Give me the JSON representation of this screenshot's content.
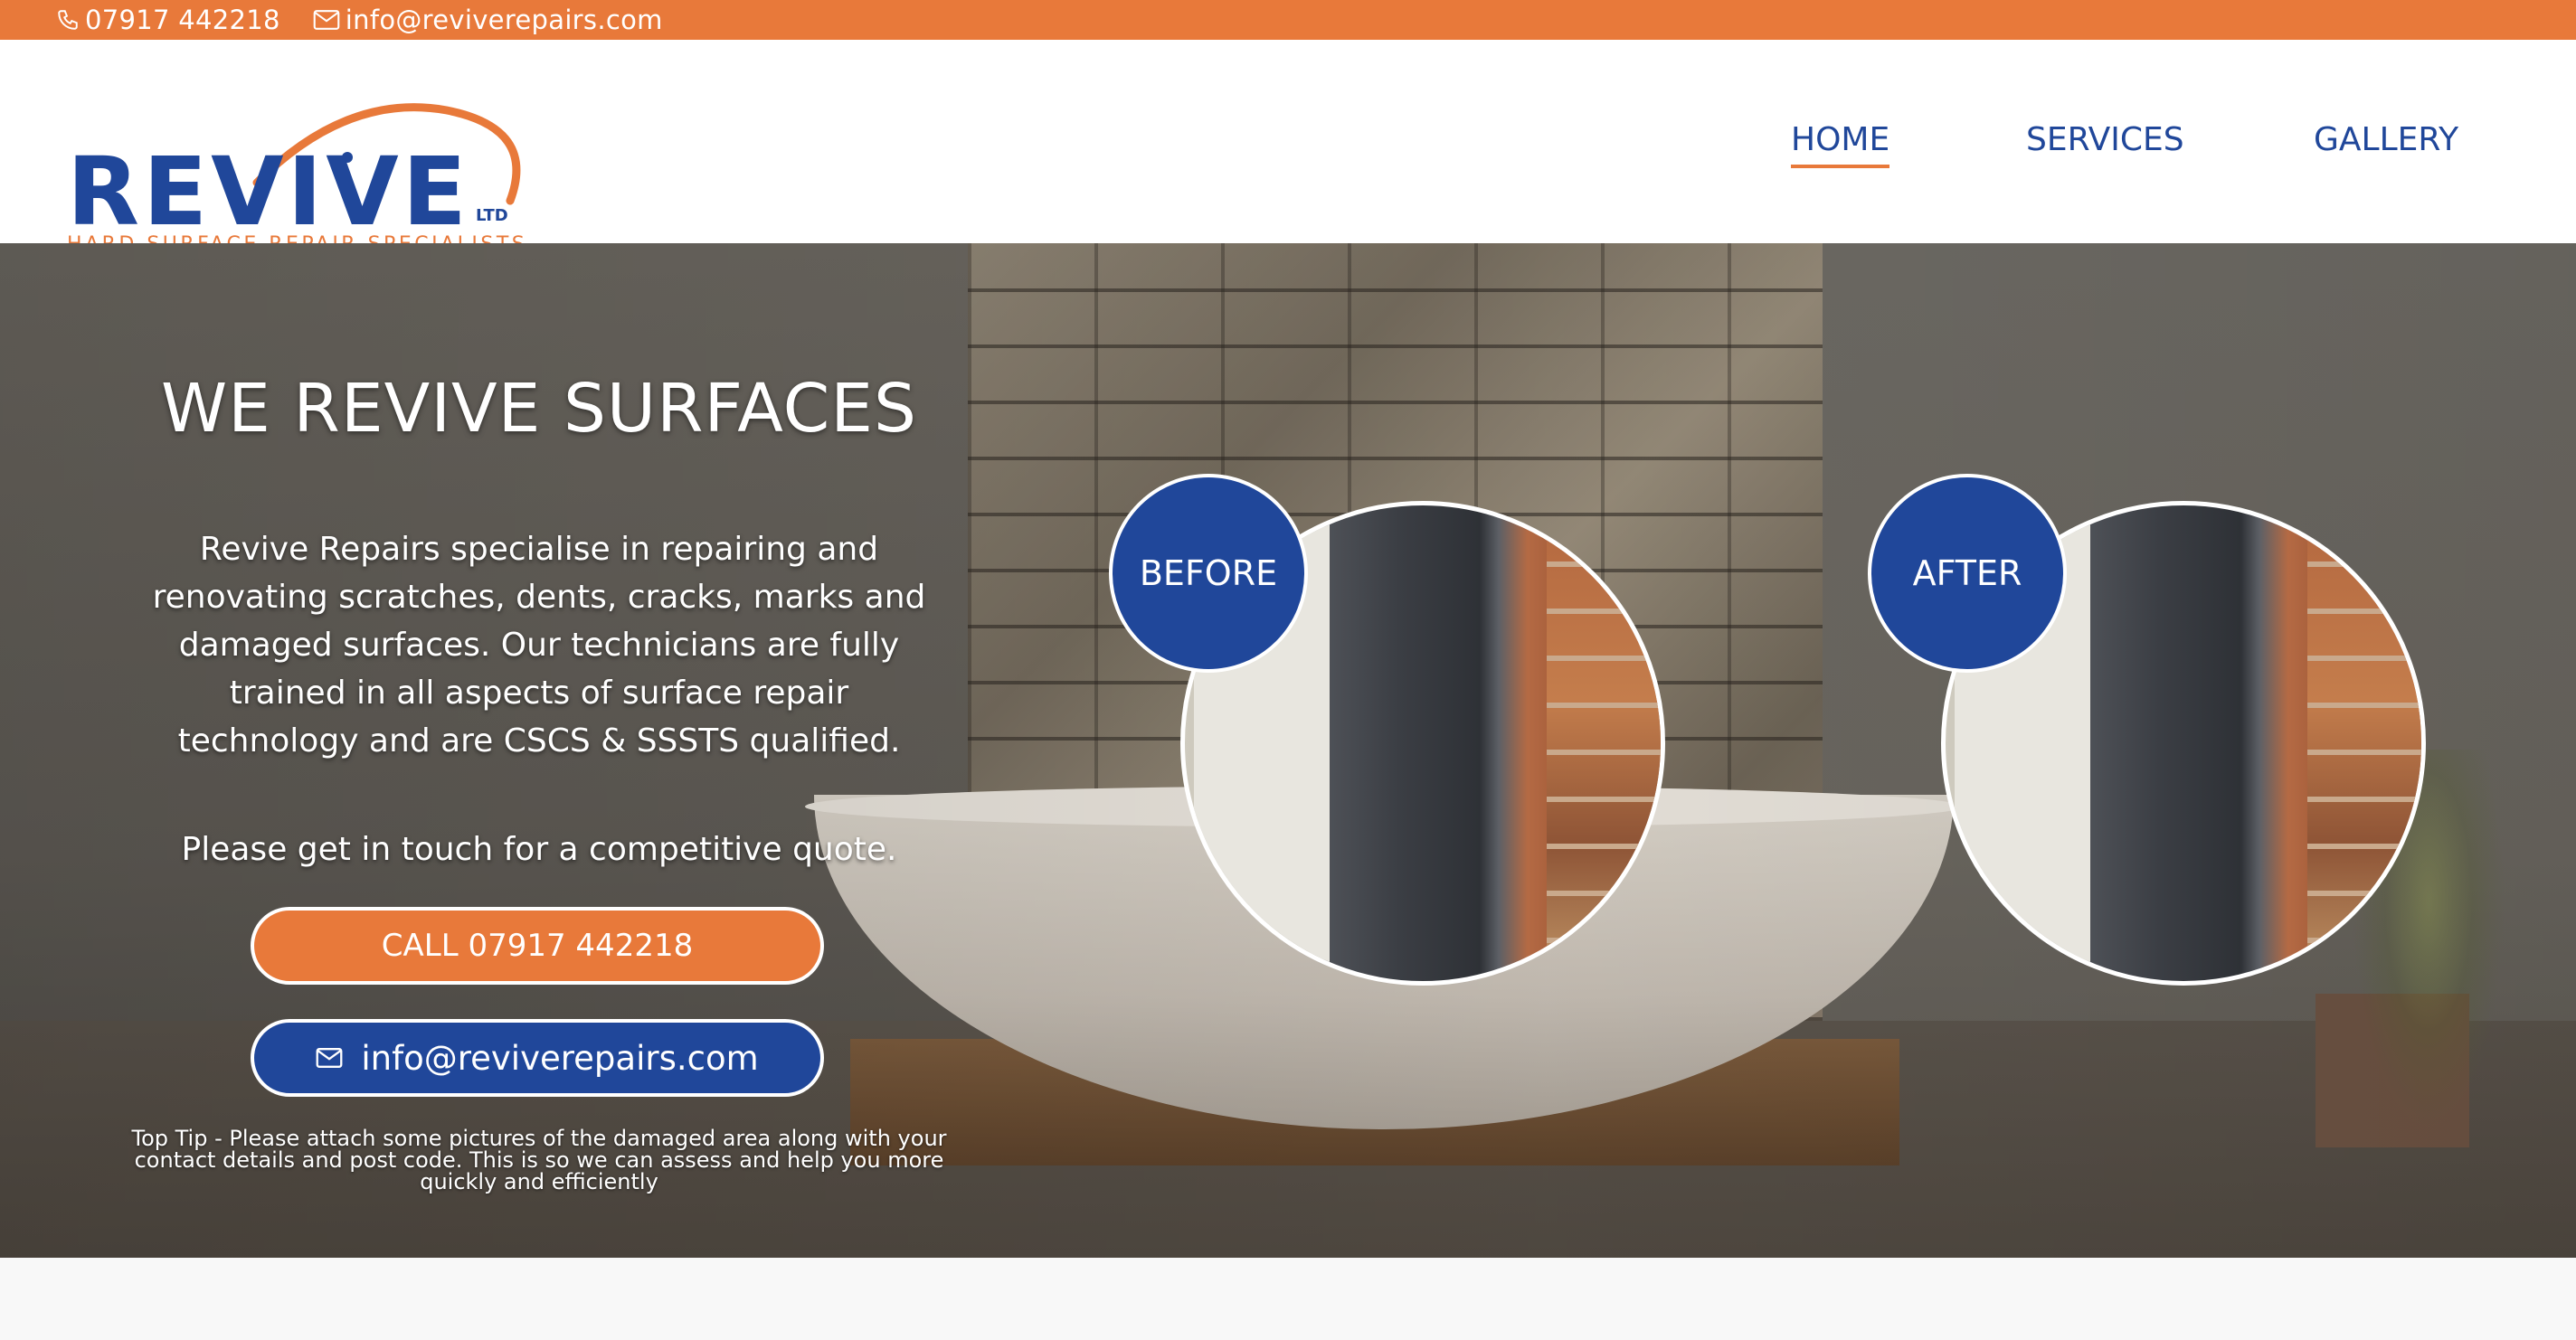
{
  "topbar": {
    "phone": "07917 442218",
    "email": "info@reviverepairs.com",
    "icons": [
      "phone-icon",
      "envelope-icon"
    ]
  },
  "logo": {
    "word": "REVIVE",
    "suffix": "LTD",
    "tagline": "HARD SURFACE REPAIR SPECIALISTS"
  },
  "nav": {
    "items": [
      "HOME",
      "SERVICES",
      "GALLERY"
    ],
    "active": "HOME"
  },
  "hero": {
    "title": "WE REVIVE SURFACES",
    "body": "Revive Repairs specialise in repairing and renovating scratches, dents, cracks, marks and damaged surfaces. Our technicians are fully trained in all aspects of surface repair technology and are CSCS & SSSTS qualified.",
    "quote": "Please get in touch for a competitive quote.",
    "call_button": "CALL 07917 442218",
    "email_button": "info@reviverepairs.com",
    "tip": "Top Tip - Please attach some pictures of the damaged area along with your contact details and post code. This is so we can assess and help you more quickly and efficiently"
  },
  "comparison": {
    "before_label": "BEFORE",
    "after_label": "AFTER"
  },
  "colors": {
    "accent": "#e8793a",
    "brand": "#20479a",
    "white": "#ffffff"
  }
}
